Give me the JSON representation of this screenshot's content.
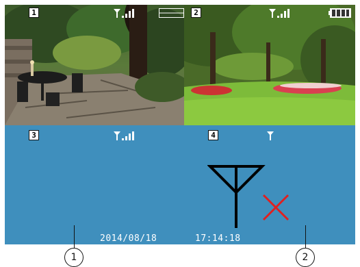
{
  "quads": [
    {
      "id": "1",
      "label": "1"
    },
    {
      "id": "2",
      "label": "2"
    },
    {
      "id": "3",
      "label": "3"
    },
    {
      "id": "4",
      "label": "4"
    }
  ],
  "status": {
    "date": "2014/08/18",
    "time": "17:14:18",
    "battery": "full"
  },
  "callouts": [
    "1",
    "2"
  ],
  "colors": {
    "no_signal_panel": "#3f8fbd",
    "no_signal_x": "#e02020"
  },
  "icons": {
    "signal": "signal-strength-icon",
    "layout": "quad-layout-icon",
    "battery": "battery-icon",
    "no_signal": "no-signal-antenna-icon"
  }
}
